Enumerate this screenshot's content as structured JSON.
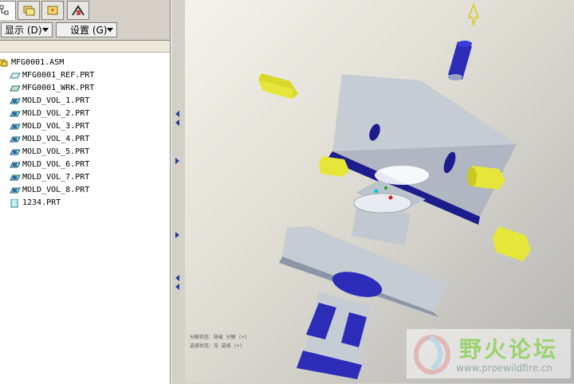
{
  "tabs": [
    {
      "name": "model-tree-icon",
      "active": true
    },
    {
      "name": "folder-browser-icon",
      "active": false
    },
    {
      "name": "favorites-icon",
      "active": false
    },
    {
      "name": "connections-icon",
      "active": false
    }
  ],
  "menus": {
    "show_label": "显示 (D)",
    "settings_label": "设置 (G)"
  },
  "tree": {
    "items": [
      {
        "label": "MFG0001.ASM",
        "icon": "assembly-icon"
      },
      {
        "label": "MFG0001_REF.PRT",
        "icon": "reference-part-icon"
      },
      {
        "label": "MFG0001_WRK.PRT",
        "icon": "workpiece-icon"
      },
      {
        "label": "MOLD_VOL_1.PRT",
        "icon": "mold-volume-icon"
      },
      {
        "label": "MOLD_VOL_2.PRT",
        "icon": "mold-volume-icon"
      },
      {
        "label": "MOLD_VOL_3.PRT",
        "icon": "mold-volume-icon"
      },
      {
        "label": "MOLD_VOL_4.PRT",
        "icon": "mold-volume-icon"
      },
      {
        "label": "MOLD_VOL_5.PRT",
        "icon": "mold-volume-icon"
      },
      {
        "label": "MOLD_VOL_6.PRT",
        "icon": "mold-volume-icon"
      },
      {
        "label": "MOLD_VOL_7.PRT",
        "icon": "mold-volume-icon"
      },
      {
        "label": "MOLD_VOL_8.PRT",
        "icon": "mold-volume-icon"
      },
      {
        "label": "1234.PRT",
        "icon": "part-icon"
      }
    ]
  },
  "viewport": {
    "messages": [
      "分解状态：缺省 分解 (+)",
      "选择状态：无 选择 (+)"
    ]
  },
  "watermark": {
    "title": "野火论坛",
    "url": "www.proewildfire.cn"
  },
  "colors": {
    "mold_face": "#c6ccd4",
    "mold_dark": "#1c1c8c",
    "slider": "#e6e63a",
    "core_blue": "#3a3ad8"
  }
}
